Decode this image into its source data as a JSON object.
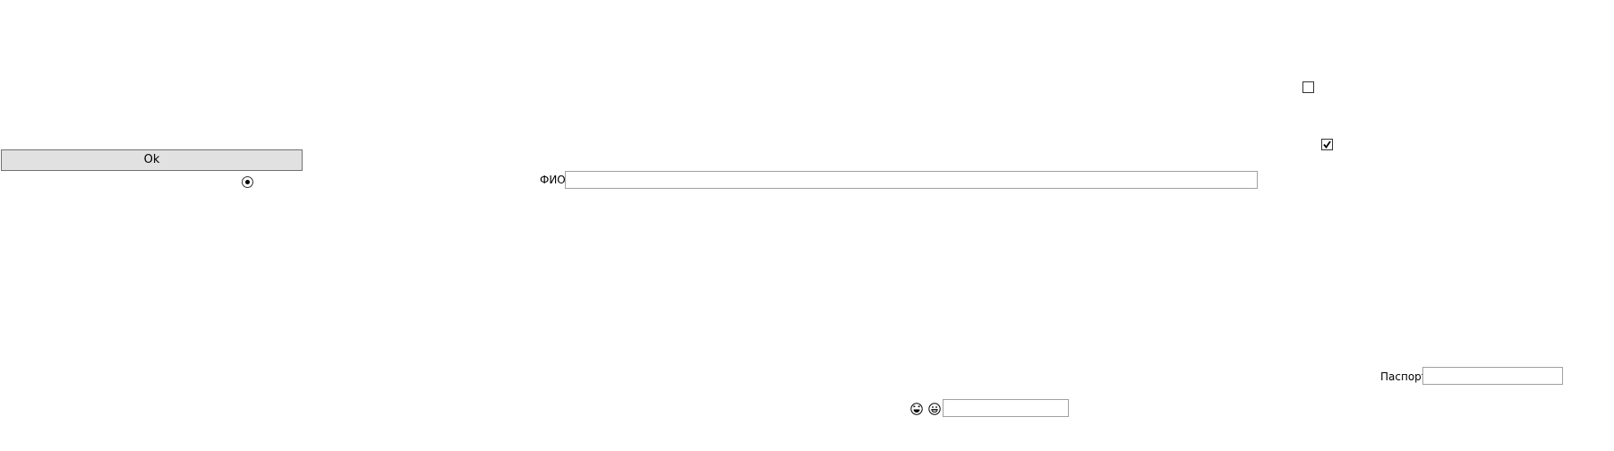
{
  "buttons": {
    "ok_label": "Ok"
  },
  "radio": {
    "checked": true
  },
  "fio": {
    "label": "ФИО",
    "value": "",
    "placeholder": ""
  },
  "checkboxes": [
    {
      "checked": false
    },
    {
      "checked": true
    }
  ],
  "passport": {
    "label": "Паспорт",
    "value": "",
    "placeholder": ""
  },
  "emoji_field": {
    "icons": [
      "laughing-face-icon",
      "grinning-face-icon"
    ],
    "value": "",
    "placeholder": ""
  }
}
